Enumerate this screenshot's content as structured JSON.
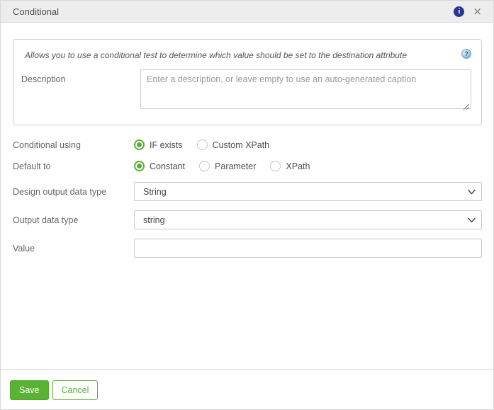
{
  "dialog": {
    "title": "Conditional"
  },
  "header_icons": {
    "info_glyph": "i",
    "close_glyph": "×"
  },
  "info_panel": {
    "hint": "Allows you to use a conditional test to determine which value should be set to the destination attribute",
    "help_glyph": "?",
    "description": {
      "label": "Description",
      "placeholder": "Enter a description, or leave empty to use an auto-generated caption",
      "value": ""
    }
  },
  "form": {
    "conditional_using": {
      "label": "Conditional using",
      "options": [
        {
          "label": "IF exists",
          "selected": true
        },
        {
          "label": "Custom XPath",
          "selected": false
        }
      ]
    },
    "default_to": {
      "label": "Default to",
      "options": [
        {
          "label": "Constant",
          "selected": true
        },
        {
          "label": "Parameter",
          "selected": false
        },
        {
          "label": "XPath",
          "selected": false
        }
      ]
    },
    "design_output_data_type": {
      "label": "Design output data type",
      "value": "String"
    },
    "output_data_type": {
      "label": "Output data type",
      "value": "string"
    },
    "value_field": {
      "label": "Value",
      "value": ""
    }
  },
  "footer": {
    "save_label": "Save",
    "cancel_label": "Cancel"
  },
  "colors": {
    "accent_green": "#5ab232",
    "info_icon_blue": "#283593",
    "header_bg": "#ededed"
  }
}
